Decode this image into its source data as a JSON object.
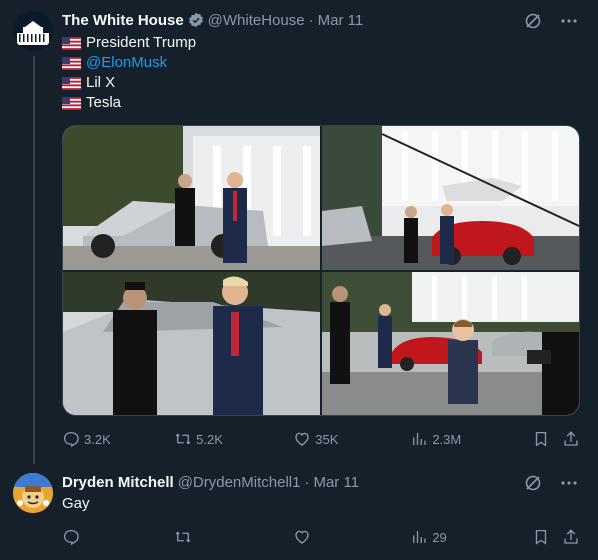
{
  "tweet": {
    "author_name": "The White House",
    "handle": "@WhiteHouse",
    "separator": "·",
    "date": "Mar 11",
    "lines": [
      {
        "text": "President Trump",
        "is_link": false
      },
      {
        "text": "@ElonMusk",
        "is_link": true
      },
      {
        "text": "Lil X",
        "is_link": false
      },
      {
        "text": "Tesla",
        "is_link": false
      }
    ],
    "stats": {
      "replies": "3.2K",
      "reposts": "5.2K",
      "likes": "35K",
      "views": "2.3M"
    }
  },
  "reply": {
    "author_name": "Dryden Mitchell",
    "handle": "@DrydenMitchell1",
    "separator": "·",
    "date": "Mar 11",
    "text": "Gay",
    "stats": {
      "replies": "",
      "reposts": "",
      "likes": "",
      "views": "29"
    }
  },
  "icons": {
    "verified": "verified-badge-icon",
    "grok": "grok-icon",
    "more": "more-icon",
    "reply": "reply-icon",
    "repost": "repost-icon",
    "like": "like-icon",
    "views": "views-icon",
    "bookmark": "bookmark-icon",
    "share": "share-icon"
  },
  "colors": {
    "background": "#15202b",
    "text": "#f7f9f9",
    "muted": "#8b98a5",
    "link": "#1d9bf0",
    "verified": "#829aab"
  }
}
